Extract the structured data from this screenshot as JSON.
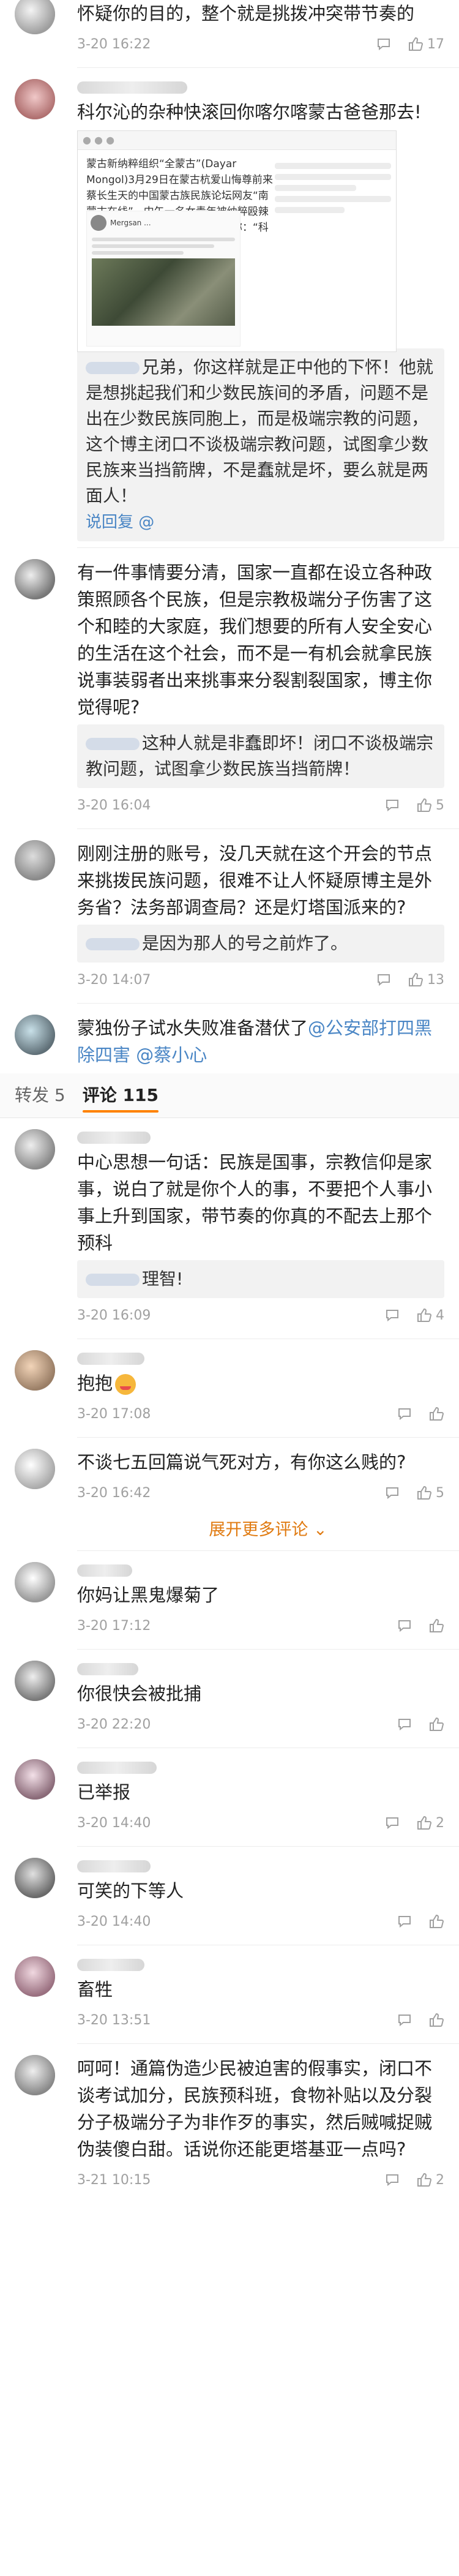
{
  "tabs": {
    "repost": "转发 5",
    "comments_label": "评论",
    "comments_count": "115"
  },
  "expand_label": "展开更多评论",
  "colors": {
    "accent": "#ff8200",
    "link": "#4a86c5",
    "meta": "#a0a0a0"
  },
  "icons": {
    "reply": "comment-icon",
    "like": "thumbs-up-icon",
    "expand": "chevron-down-icon"
  },
  "top_comment": {
    "text": "怀疑你的目的，整个就是挑拨冲突带节奏的",
    "time": "3-20 16:22",
    "likes": "17"
  },
  "comment_screenshot": {
    "text": "科尔沁的杂种快滚回你喀尔喀蒙古爸爸那去!",
    "quote": "蒙古新纳粹组织“全蒙古”(Dayar Mongol)3月29日在蒙古杭爱山悔尊前来蔡长生天的中国蒙古族民族论坛网友“南蒙古在线”，中午一名女青年被纳粹殴辣蒙古独。日本独与包头，并侮辱称：“科尔沁蒙古滚回中国。”",
    "reply_text": "兄弟，你这样就是正中他的下怀！他就是想挑起我们和少数民族间的矛盾，问题不是出在少数民族同胞上，而是极端宗教的问题，这个博主闭口不谈极端宗教问题，试图拿少数民族来当挡箭牌，不是蠢就是坏，要么就是两面人！",
    "reply_link": "说回复 @"
  },
  "comments": [
    {
      "text": "有一件事情要分清，国家一直都在设立各种政策照顾各个民族，但是宗教极端分子伤害了这个和睦的大家庭，我们想要的所有人安全安心的生活在这个社会，而不是一有机会就拿民族说事装弱者出来挑事来分裂割裂国家，博主你觉得呢?",
      "reply": "这种人就是非蠢即坏！闭口不谈极端宗教问题，试图拿少数民族当挡箭牌！",
      "time": "3-20 16:04",
      "likes": "5"
    },
    {
      "text": "刚刚注册的账号，没几天就在这个开会的节点来挑拨民族问题，很难不让人怀疑原博主是外务省？法务部调查局？还是灯塔国派来的?",
      "reply": "是因为那人的号之前炸了。",
      "time": "3-20 14:07",
      "likes": "13"
    },
    {
      "text_prefix": "蒙独份子试水失败准备潜伏了",
      "mention1": "@公安部打四黑除四害",
      "mention2": "@蔡小心"
    },
    {
      "text": "中心思想一句话：民族是国事，宗教信仰是家事，说白了就是你个人的事，不要把个人事小事上升到国家，带节奏的你真的不配去上那个预科",
      "reply": "理智!",
      "time": "3-20 16:09",
      "likes": "4"
    },
    {
      "text": "抱抱",
      "time": "3-20 17:08",
      "likes": ""
    },
    {
      "text": "不谈七五回篇说气死对方，有你这么贱的?",
      "time": "3-20 16:42",
      "likes": "5"
    },
    {
      "text": "你妈让黑鬼爆菊了",
      "time": "3-20 17:12",
      "likes": ""
    },
    {
      "text": "你很快会被批捕",
      "time": "3-20 22:20",
      "likes": ""
    },
    {
      "text": "已举报",
      "time": "3-20 14:40",
      "likes": "2"
    },
    {
      "text": "可笑的下等人",
      "time": "3-20 14:40",
      "likes": ""
    },
    {
      "text": "畜牲",
      "time": "3-20 13:51",
      "likes": ""
    },
    {
      "text": "呵呵！通篇伪造少民被迫害的假事实，闭口不谈考试加分，民族预科班，食物补贴以及分裂分子极端分子为非作歹的事实，然后贼喊捉贼伪装傻白甜。话说你还能更塔基亚一点吗?",
      "time": "3-21 10:15",
      "likes": "2"
    }
  ]
}
